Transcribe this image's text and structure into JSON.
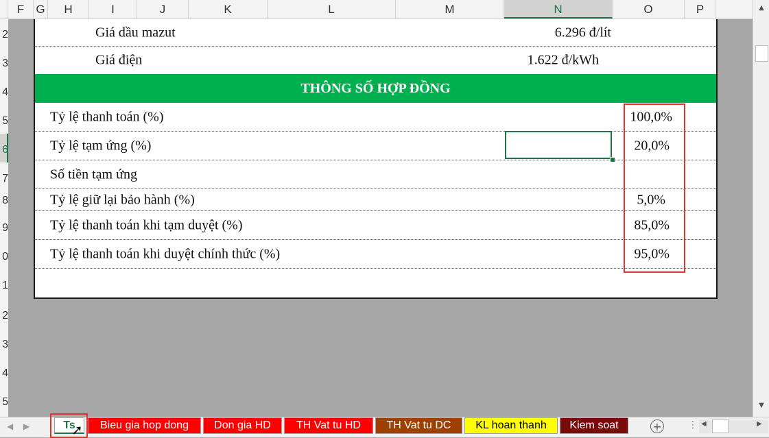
{
  "column_headers": [
    "F",
    "G",
    "H",
    "I",
    "J",
    "K",
    "L",
    "M",
    "N",
    "O",
    "P"
  ],
  "active_column": "N",
  "row_numbers": [
    "2",
    "3",
    "4",
    "5",
    "6",
    "7",
    "8",
    "9",
    "0",
    "1",
    "2",
    "3",
    "4",
    "5"
  ],
  "active_row": "6",
  "sheet": {
    "fuel_rows": [
      {
        "label": "Giá dầu mazut",
        "value": "6.296 đ/lít"
      },
      {
        "label": "Giá điện",
        "value": "1.622 đ/kWh"
      }
    ],
    "section_title": "THÔNG SỐ HỢP ĐỒNG",
    "params": [
      {
        "label": "Tỷ lệ thanh toán (%)",
        "value": "100,0%"
      },
      {
        "label": "Tỷ lệ tạm ứng (%)",
        "value": "20,0%"
      },
      {
        "label": "Số tiền tạm ứng",
        "value": ""
      },
      {
        "label": "Tỷ lệ giữ lại bảo hành (%)",
        "value": "5,0%"
      },
      {
        "label": "Tỷ lệ thanh toán khi tạm duyệt (%)",
        "value": "85,0%"
      },
      {
        "label": "Tỷ lệ thanh toán khi duyệt chính thức (%)",
        "value": "95,0%"
      }
    ]
  },
  "tabs": [
    {
      "label": "Ts",
      "bg": "#ffffff",
      "color": "#217346"
    },
    {
      "label": "Bieu gia hop dong",
      "bg": "#ff0000",
      "color": "#ffffff"
    },
    {
      "label": "Don gia HD",
      "bg": "#ff0000",
      "color": "#ffffff"
    },
    {
      "label": "TH Vat tu HD",
      "bg": "#ff0000",
      "color": "#ffffff"
    },
    {
      "label": "TH Vat tu DC",
      "bg": "#a04000",
      "color": "#ffffff"
    },
    {
      "label": "KL hoan thanh",
      "bg": "#ffff00",
      "color": "#000000"
    },
    {
      "label": "Kiem soat",
      "bg": "#7b0a0a",
      "color": "#ffffff"
    }
  ],
  "icons": {
    "add_sheet": "plus-circle-icon",
    "more": "ellipsis-icon",
    "scroll_up": "triangle-up-icon",
    "scroll_down": "triangle-down-icon"
  },
  "colors": {
    "header_green": "#00b050",
    "highlight_red": "#e2312f",
    "selection_green": "#217346"
  }
}
